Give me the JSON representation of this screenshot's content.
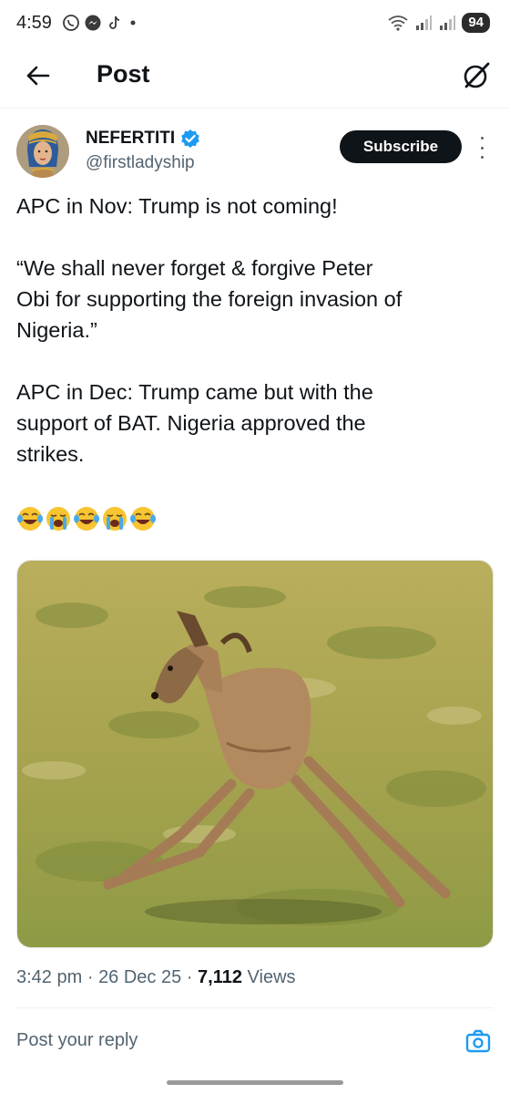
{
  "status_bar": {
    "time": "4:59",
    "battery": "94",
    "icons": [
      "whatsapp-icon",
      "messenger-icon",
      "tiktok-icon",
      "dot-icon",
      "wifi-icon",
      "signal-icon",
      "signal-icon",
      "battery-icon"
    ]
  },
  "header": {
    "title": "Post",
    "back_icon": "arrow-left-icon",
    "grok_icon": "grok-icon"
  },
  "post": {
    "author": {
      "name": "NEFERTITI",
      "handle": "@firstladyship",
      "verified": true,
      "verified_color": "#1d9bf0"
    },
    "subscribe_label": "Subscribe",
    "text": {
      "line1": "APC in Nov: Trump is not coming!",
      "quote_line1": "“We shall never forget & forgive Peter",
      "quote_line2": "Obi for supporting the foreign invasion of",
      "quote_line3": "Nigeria.”",
      "line3a": "APC in Dec: Trump came but with the",
      "line3b": "support of BAT. Nigeria approved the",
      "line3c": "strikes."
    },
    "emojis": [
      "laughing-crying-emoji",
      "loudly-crying-emoji",
      "laughing-crying-emoji",
      "loudly-crying-emoji",
      "laughing-crying-emoji"
    ],
    "media": {
      "type": "photo",
      "icon": "greyhound-dog-photo"
    },
    "time": "3:42 pm",
    "separator": "·",
    "date": "26 Dec 25",
    "views_count": "7,112",
    "views_label": "Views"
  },
  "reply": {
    "placeholder": "Post your reply",
    "camera_icon": "camera-icon"
  },
  "colors": {
    "text": "#0f1419",
    "secondary": "#536471",
    "accent": "#1d9bf0",
    "button_bg": "#0f1419"
  }
}
